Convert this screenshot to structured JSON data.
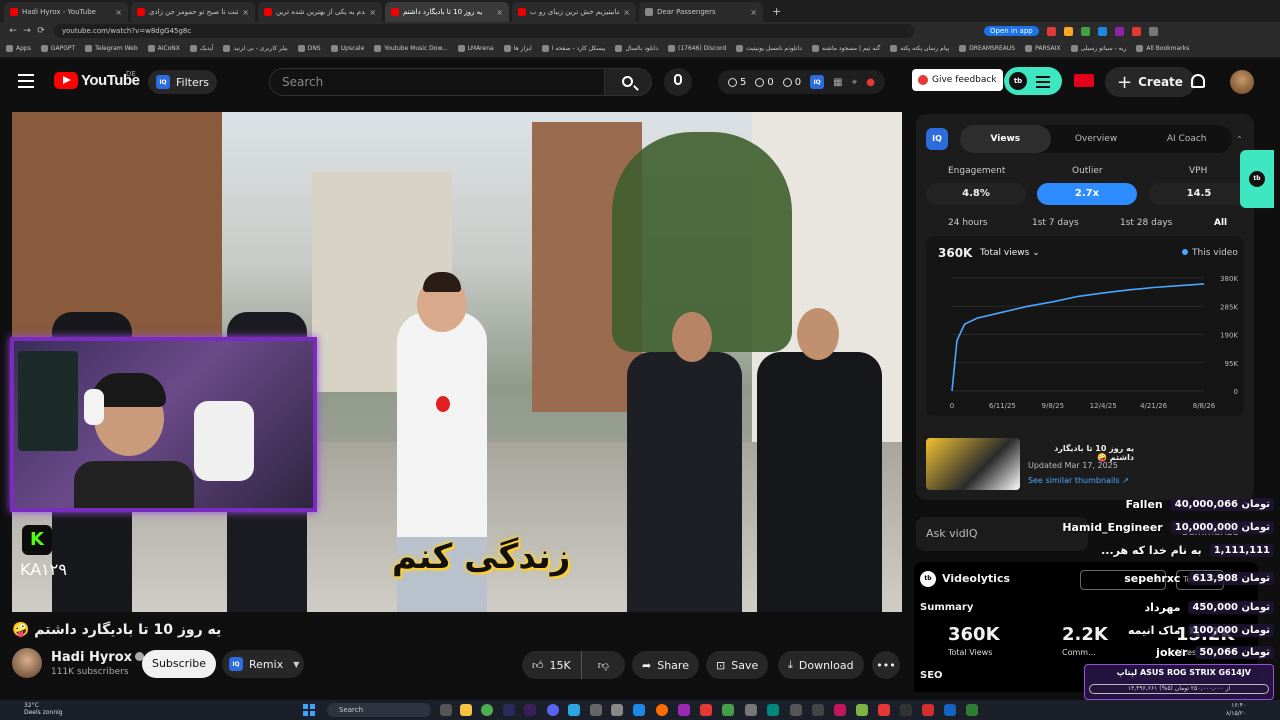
{
  "browser": {
    "tabs": [
      {
        "title": "Hadi Hyrox - YouTube",
        "active": false
      },
      {
        "title": "از شت تا صبح تو حمومر جن زادی",
        "active": false
      },
      {
        "title": "دیدم به یکی از بهترین شده ترین",
        "active": false
      },
      {
        "title": "یه روز 10 تا بادیگارد داشتم",
        "active": true
      },
      {
        "title": "برای مانیتیزیم خش ترین زیبای رو ب",
        "active": false
      },
      {
        "title": "Dear Passengers",
        "active": false
      }
    ],
    "new_tab": "+",
    "url": "youtube.com/watch?v=w8dgG45g8c",
    "open_in_app": "Open in app",
    "bookmarks": [
      "Apps",
      "GAPGPT",
      "Telegram Web",
      "AiCoNX",
      "آیدیک",
      "بیلر کاربری - بی لرنید",
      "DNS",
      "Upscale",
      "Youtube Music Dow...",
      "LMArena",
      "ابزار ها",
      "بیسکل کارد - صفحه ا",
      "دانلود بالسال",
      "(17646) Discord",
      "دانلودم نامسل یونیتیت",
      "گنه تیم | مسجود ماشنه",
      "پیام رسان پکته پکته",
      "DREAMSREAUS",
      "PARSAIX",
      "ریه - سیاتو رسیلی",
      "All Bookmarks"
    ]
  },
  "masthead": {
    "logo_text": "YouTube",
    "region": "DE",
    "filters_label": "Filters",
    "search_placeholder": "Search",
    "stats": {
      "a": "5",
      "b": "0",
      "c": "0"
    },
    "feedback_label": "Give feedback",
    "create_label": "Create"
  },
  "player": {
    "caption": "زندگی کنم",
    "kick_logo": "K",
    "kick_channel": "KA۱۲۹"
  },
  "video": {
    "title": "یه روز 10 تا بادیگارد داشتم 🤪",
    "channel_name": "Hadi Hyrox",
    "subscribers": "111K subscribers",
    "subscribe_label": "Subscribe",
    "remix_label": "Remix",
    "likes": "15K",
    "share_label": "Share",
    "save_label": "Save",
    "download_label": "Download"
  },
  "vidiq": {
    "logo": "IQ",
    "tabs": [
      {
        "label": "Views",
        "active": true
      },
      {
        "label": "Overview",
        "active": false
      },
      {
        "label": "AI Coach",
        "active": false
      }
    ],
    "metrics": [
      {
        "label": "Engagement",
        "value": "4.8%",
        "highlight": false
      },
      {
        "label": "Outlier",
        "value": "2.7x",
        "highlight": true
      },
      {
        "label": "VPH",
        "value": "14.5",
        "highlight": false
      }
    ],
    "ranges": [
      {
        "label": "24 hours",
        "active": false
      },
      {
        "label": "1st 7 days",
        "active": false
      },
      {
        "label": "1st 28 days",
        "active": false
      },
      {
        "label": "All",
        "active": true
      }
    ],
    "chart_header": {
      "total": "360K",
      "selector": "Total views",
      "legend": "This video"
    },
    "thumbnail": {
      "title": "یه روز 10 تا بادیگارد داشتم 🤪",
      "updated": "Updated Mar 17, 2025",
      "link": "See similar thumbnails ↗"
    },
    "ask_placeholder": "Ask vidIQ",
    "summarize_label": "Summarize"
  },
  "chart_data": {
    "type": "line",
    "title": "",
    "xlabel": "",
    "ylabel": "",
    "x_ticks": [
      "0",
      "6/11/25",
      "9/8/25",
      "12/4/25",
      "4/21/26",
      "8/8/26"
    ],
    "y_ticks": [
      "0",
      "95K",
      "190K",
      "285K",
      "380K"
    ],
    "ylim": [
      0,
      380000
    ],
    "series": [
      {
        "name": "This video",
        "color": "#4aa6ff",
        "x": [
          0,
          0.02,
          0.05,
          0.1,
          0.15,
          0.2,
          0.3,
          0.4,
          0.5,
          0.6,
          0.7,
          0.8,
          0.9,
          1.0
        ],
        "values": [
          0,
          170000,
          225000,
          245000,
          255000,
          265000,
          285000,
          300000,
          318000,
          330000,
          340000,
          348000,
          354000,
          360000
        ]
      }
    ]
  },
  "videolytics": {
    "title": "Videolytics",
    "off_label": "Off",
    "tools_label": "Tools",
    "summary_label": "Summary",
    "total_views": "360K",
    "total_views_label": "Total Views",
    "comments": "2.2K",
    "comments_label": "Comm...",
    "likes": "15.2K",
    "likes_label": "Likes",
    "seo_label": "SEO"
  },
  "donations": [
    {
      "name": "Fallen",
      "amount": "40,000,066 تومان"
    },
    {
      "name": "Hamid_Engineer",
      "amount": "10,000,000 تومان"
    },
    {
      "name": "...به نام خدا که هر",
      "amount": "1,111,111"
    },
    {
      "name": "sepehrxc",
      "amount": "613,908 تومان"
    },
    {
      "name": "مهرداد",
      "amount": "450,000 تومان"
    },
    {
      "name": "ماک انیمه",
      "amount": "100,000 تومان"
    },
    {
      "name": "joker",
      "amount": "50,066 تومان"
    }
  ],
  "promo": {
    "text": "لپتاپ ASUS ROG STRIX G614JV",
    "progress": "۱۳,۴۹۶,۶۶۱ از ۲۵۰,۰۰۰,۰۰۰ تومان (۵%)"
  },
  "taskbar": {
    "weather_temp": "32°C",
    "weather_desc": "Deels zonnig",
    "search_label": "Search",
    "time": "۱۶:۴۰",
    "date": "۸/۱۵/۲۰"
  }
}
